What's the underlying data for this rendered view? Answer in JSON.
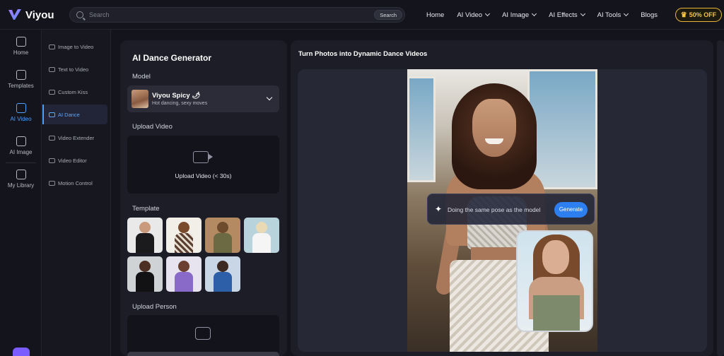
{
  "brand": {
    "name": "Viyou"
  },
  "search": {
    "placeholder": "Search",
    "button": "Search"
  },
  "nav": {
    "items": [
      {
        "label": "Home",
        "dropdown": false
      },
      {
        "label": "AI Video",
        "dropdown": true
      },
      {
        "label": "AI Image",
        "dropdown": true
      },
      {
        "label": "AI Effects",
        "dropdown": true
      },
      {
        "label": "AI Tools",
        "dropdown": true
      },
      {
        "label": "Blogs",
        "dropdown": false
      }
    ],
    "promo": "50% OFF"
  },
  "rail": {
    "items": [
      {
        "label": "Home",
        "icon": "home-icon"
      },
      {
        "label": "Templates",
        "icon": "templates-icon"
      },
      {
        "label": "AI Video",
        "icon": "video-icon",
        "active": true
      },
      {
        "label": "AI Image",
        "icon": "image-icon"
      },
      {
        "label": "My Library",
        "icon": "library-icon"
      }
    ]
  },
  "subnav": {
    "items": [
      {
        "label": "Image to Video"
      },
      {
        "label": "Text to Video"
      },
      {
        "label": "Custom Kiss"
      },
      {
        "label": "AI Dance",
        "active": true
      },
      {
        "label": "Video Extender"
      },
      {
        "label": "Video Editor"
      },
      {
        "label": "Motion Control"
      }
    ]
  },
  "panel": {
    "title": "AI Dance Generator",
    "model_label": "Model",
    "model_name": "Viyou Spicy",
    "model_emoji": "🌶",
    "model_desc": "Hot dancing, sexy moves",
    "upload_video_label": "Upload Video",
    "upload_video_text": "Upload Video (< 30s)",
    "template_label": "Template",
    "upload_person_label": "Upload Person"
  },
  "main": {
    "title": "Turn Photos into Dynamic Dance Videos",
    "tooltip": "Doing the same pose as the model",
    "generate": "Generate"
  },
  "colors": {
    "accent": "#4ea1ff",
    "generate": "#2d7ff0",
    "promo": "#f3c14e"
  }
}
